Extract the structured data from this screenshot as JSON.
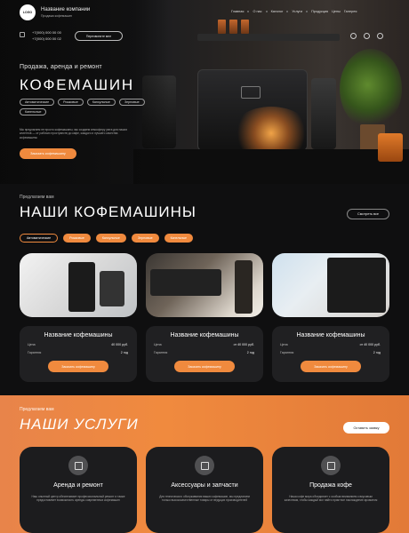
{
  "header": {
    "logo_text": "LOGO",
    "company_name": "Название компании",
    "company_sub": "Продажа кофемашин",
    "nav": [
      "Главная",
      "О нас",
      "Каталог",
      "Услуги",
      "Продукция",
      "Цены",
      "Галерея"
    ],
    "phones": [
      "+7(000) 000 00 00",
      "+7(000) 000 00 02"
    ],
    "callback_label": "Перезвоните мне",
    "social_icons": [
      "telegram-icon",
      "viber-icon",
      "whatsapp-icon"
    ]
  },
  "hero": {
    "subtitle": "Продажа, аренда и ремонт",
    "title": "КОФЕМАШИН",
    "chips": [
      "Автоматические",
      "Рожковые",
      "Капсульные",
      "Зерновые",
      "Капельные"
    ],
    "description": "Мы предлагаем не просто кофемашины, мы создаем атмосферу уюта для наших клиентов — от рабочих пространств до кафе, каждого и лучшего качества кофемашины",
    "button_label": "Заказать кофемашину"
  },
  "machines": {
    "offer_label": "Предлагаем вам",
    "title": "НАШИ КОФЕМАШИНЫ",
    "see_all_label": "Смотреть все",
    "filters": [
      "Автоматические",
      "Рожковые",
      "Капсульные",
      "Зерновые",
      "Капельные"
    ],
    "active_filter_index": 0,
    "cards": [
      {
        "name": "Название кофемашины",
        "price_label": "Цена",
        "price": "40 000 руб.",
        "warranty_label": "Гарантия",
        "warranty": "2 год",
        "button": "Заказать кофемашину"
      },
      {
        "name": "Название кофемашины",
        "price_label": "Цена",
        "price": "от 40 000 руб.",
        "warranty_label": "Гарантия",
        "warranty": "2 год",
        "button": "Заказать кофемашину"
      },
      {
        "name": "Название кофемашины",
        "price_label": "Цена",
        "price": "от 40 000 руб.",
        "warranty_label": "Гарантия",
        "warranty": "2 год",
        "button": "Заказать кофемашину"
      }
    ]
  },
  "services": {
    "offer_label": "Предлагаем вам",
    "title": "НАШИ УСЛУГИ",
    "order_label": "Оставить заявку",
    "items": [
      {
        "title": "Аренда и ремонт",
        "icon": "coffee-machine-icon",
        "desc": "Наш опытный центр обеспечивает профессиональный ремонт и также предоставляет возможность аренды современных кофемашин"
      },
      {
        "title": "Аксессуары и запчасти",
        "icon": "parts-icon",
        "desc": "Для технического обслуживания ваших кофемашин, мы предлагаем только высококачественные товары от ведущих производителей"
      },
      {
        "title": "Продажа кофе",
        "icon": "coffee-bag-icon",
        "desc": "Наша кофе мира объединяет с особым вниманием к вкусовым качествам, чтобы каждый мог найти приятное наслаждение ароматом"
      }
    ]
  },
  "colors": {
    "accent": "#f08a3e",
    "dark": "#0f0f10",
    "card": "#202022"
  }
}
